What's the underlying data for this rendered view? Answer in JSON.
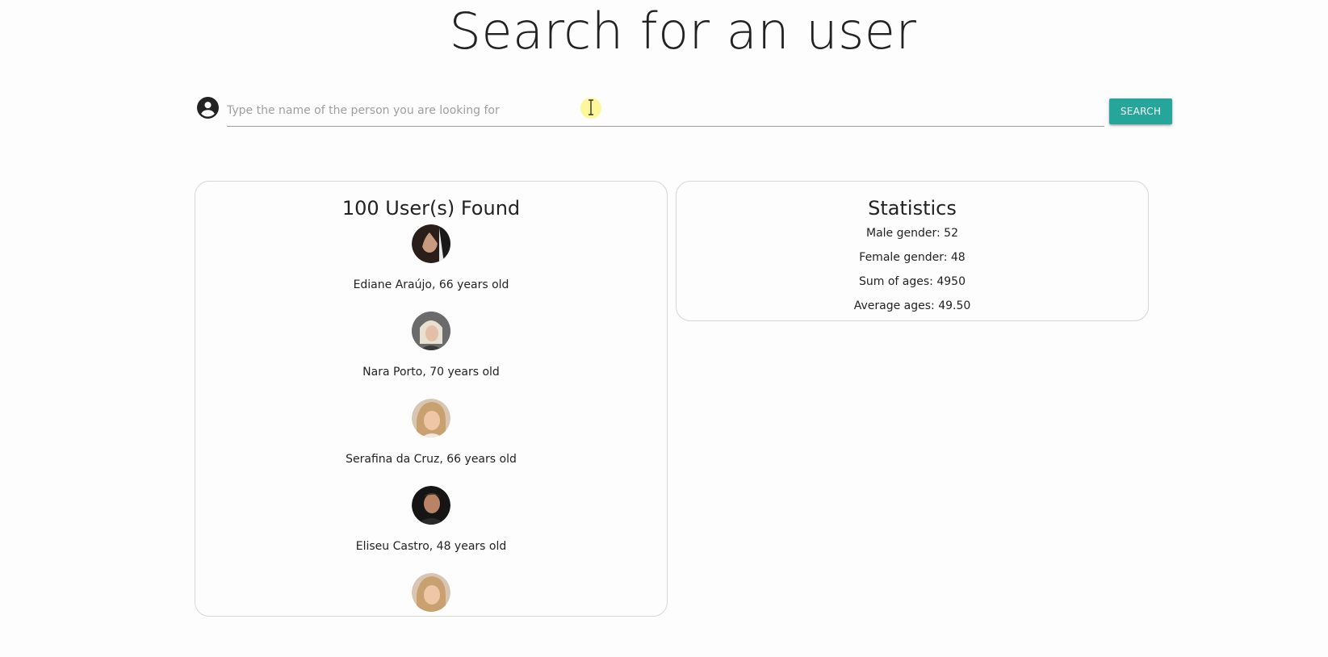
{
  "page": {
    "title": "Search for an user"
  },
  "search": {
    "placeholder": "Type the name of the person you are looking for",
    "value": "",
    "button_label": "SEARCH",
    "icon": "account-circle-icon",
    "accent_color": "#26a69a"
  },
  "results": {
    "heading": "100 User(s) Found",
    "users": [
      {
        "label": "Ediane Araújo, 66 years old",
        "avatar": "avatar-photo-icon"
      },
      {
        "label": "Nara Porto, 70 years old",
        "avatar": "avatar-photo-icon"
      },
      {
        "label": "Serafina da Cruz, 66 years old",
        "avatar": "avatar-photo-icon"
      },
      {
        "label": "Eliseu Castro, 48 years old",
        "avatar": "avatar-photo-icon"
      },
      {
        "label": "",
        "avatar": "avatar-photo-icon"
      }
    ]
  },
  "statistics": {
    "heading": "Statistics",
    "male": "Male gender: 52",
    "female": "Female gender: 48",
    "sum_ages": "Sum of ages: 4950",
    "average_ages": "Average ages: 49.50"
  }
}
